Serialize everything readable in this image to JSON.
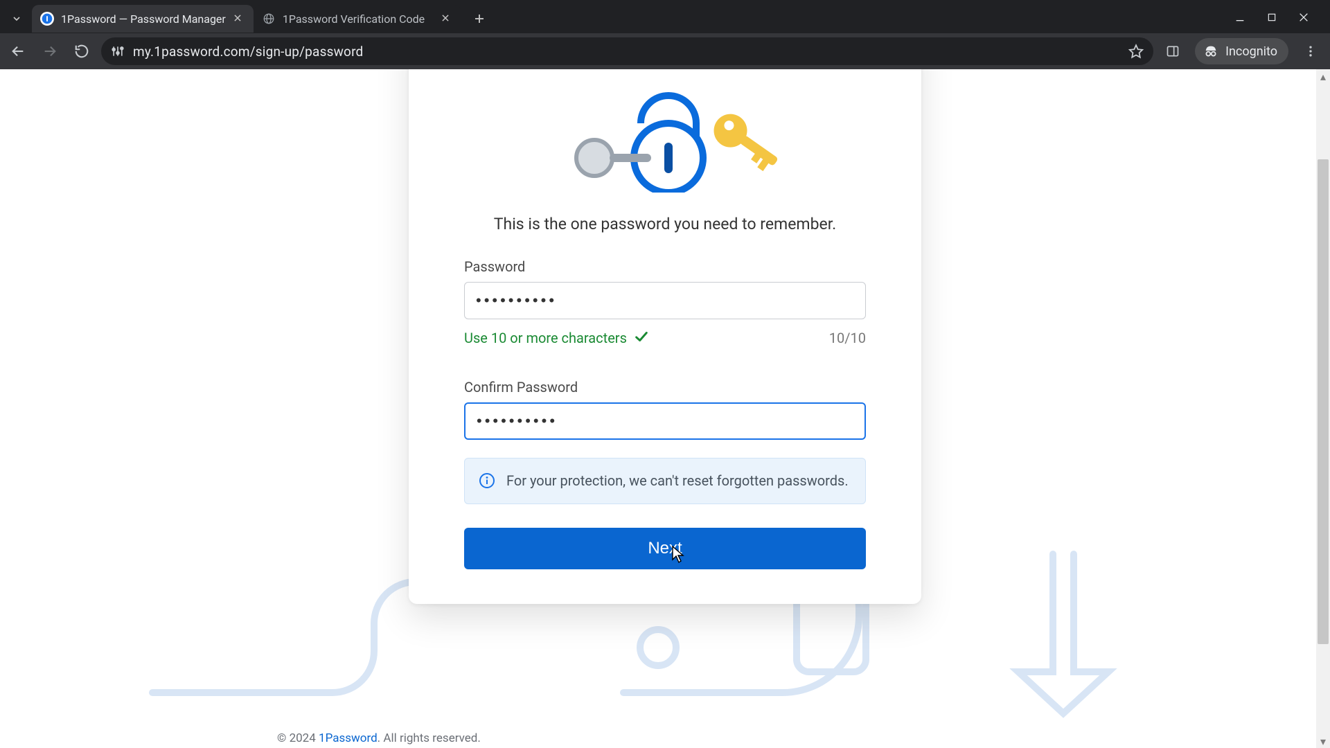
{
  "browser": {
    "tabs": [
      {
        "title": "1Password — Password Manager",
        "active": true
      },
      {
        "title": "1Password Verification Code",
        "active": false
      }
    ],
    "url": "my.1password.com/sign-up/password",
    "incognito_label": "Incognito"
  },
  "page": {
    "subtitle": "This is the one password you need to remember.",
    "password_label": "Password",
    "password_value": "••••••••••",
    "hint_text": "Use 10 or more characters",
    "char_counter": "10/10",
    "confirm_label": "Confirm Password",
    "confirm_value": "••••••••••",
    "info_text": "For your protection, we can't reset forgotten passwords.",
    "next_label": "Next",
    "footer_prefix": "© 2024 ",
    "footer_link": "1Password",
    "footer_suffix": ". All rights reserved."
  }
}
